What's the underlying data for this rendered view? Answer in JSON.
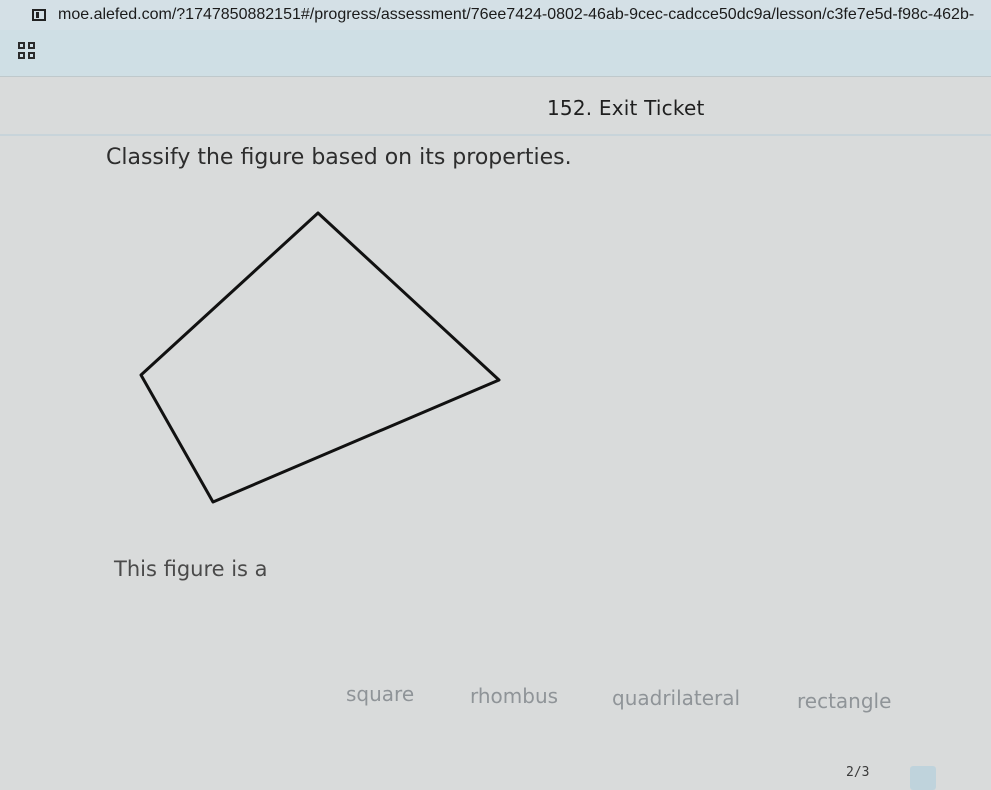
{
  "browser": {
    "url": "moe.alefed.com/?1747850882151#/progress/assessment/76ee7424-0802-46ab-9cec-cadcce50dc9a/lesson/c3fe7e5d-f98c-462b-"
  },
  "header": {
    "lesson_title": "152. Exit Ticket",
    "menu_icon": "grid-icon"
  },
  "question": {
    "prompt": "Classify the figure based on its properties.",
    "figure": "quadrilateral-outline",
    "statement": "This figure is a"
  },
  "answer_options": [
    {
      "label": "square"
    },
    {
      "label": "rhombus"
    },
    {
      "label": "quadrilateral"
    },
    {
      "label": "rectangle"
    }
  ],
  "footer": {
    "page_counter": "2/3"
  },
  "colors": {
    "background": "#d9dbdb",
    "app_bar": "#cfdfe5",
    "option_text": "#8f9498",
    "figure_stroke": "#111111"
  }
}
